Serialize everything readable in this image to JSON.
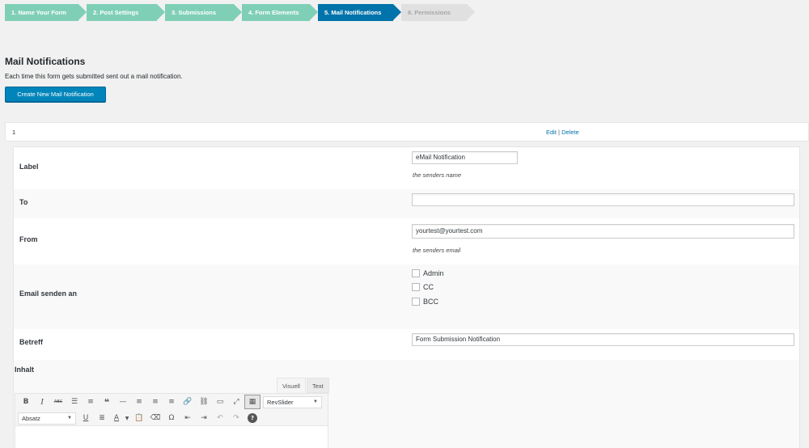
{
  "steps": [
    {
      "label": "1. Name Your Form"
    },
    {
      "label": "2. Post Settings"
    },
    {
      "label": "3. Submissions"
    },
    {
      "label": "4. Form Elements"
    },
    {
      "label": "5. Mail Notifications"
    },
    {
      "label": "6. Permissions"
    }
  ],
  "page": {
    "title": "Mail Notifications",
    "description": "Each time this form gets submitted sent out a mail notification.",
    "create_button": "Create New Mail Notification"
  },
  "notification": {
    "number": "1",
    "edit": "Edit",
    "separator": "|",
    "delete": "Delete"
  },
  "form": {
    "label": {
      "label": "Label",
      "value": "eMail Notification",
      "hint": "the senders name"
    },
    "to": {
      "label": "To",
      "value": ""
    },
    "from": {
      "label": "From",
      "value": "yourtest@yourtest.com",
      "hint": "the senders email"
    },
    "send_to": {
      "label": "Email senden an",
      "options": [
        "Admin",
        "CC",
        "BCC"
      ]
    },
    "subject": {
      "label": "Betreff",
      "value": "Form Submission Notification"
    },
    "content": {
      "label": "Inhalt"
    }
  },
  "editor": {
    "tab_visual": "Visuell",
    "tab_text": "Text",
    "shortcode_select": "RevSlider",
    "format_select": "Absatz",
    "toolbar_row1": [
      {
        "name": "bold-icon",
        "glyph": "B"
      },
      {
        "name": "italic-icon",
        "glyph": "I"
      },
      {
        "name": "strikethrough-icon",
        "glyph": "ABC"
      },
      {
        "name": "bullet-list-icon",
        "glyph": "☰"
      },
      {
        "name": "numbered-list-icon",
        "glyph": "≡"
      },
      {
        "name": "blockquote-icon",
        "glyph": "❝"
      },
      {
        "name": "horizontal-rule-icon",
        "glyph": "—"
      },
      {
        "name": "align-left-icon",
        "glyph": "≡"
      },
      {
        "name": "align-center-icon",
        "glyph": "≡"
      },
      {
        "name": "align-right-icon",
        "glyph": "≡"
      },
      {
        "name": "link-icon",
        "glyph": "🔗"
      },
      {
        "name": "unlink-icon",
        "glyph": "⛓"
      },
      {
        "name": "read-more-icon",
        "glyph": "▭"
      },
      {
        "name": "fullscreen-icon",
        "glyph": "⤢"
      },
      {
        "name": "toolbar-toggle-icon",
        "glyph": "▦"
      }
    ],
    "toolbar_row2": [
      {
        "name": "underline-icon",
        "glyph": "U"
      },
      {
        "name": "justify-icon",
        "glyph": "≣"
      },
      {
        "name": "text-color-icon",
        "glyph": "A"
      },
      {
        "name": "paste-text-icon",
        "glyph": "📋"
      },
      {
        "name": "clear-formatting-icon",
        "glyph": "⌫"
      },
      {
        "name": "special-character-icon",
        "glyph": "Ω"
      },
      {
        "name": "outdent-icon",
        "glyph": "⇤"
      },
      {
        "name": "indent-icon",
        "glyph": "⇥"
      },
      {
        "name": "undo-icon",
        "glyph": "↶"
      },
      {
        "name": "redo-icon",
        "glyph": "↷"
      },
      {
        "name": "help-icon",
        "glyph": "?"
      }
    ]
  },
  "colors": {
    "step_done": "#7fcfb6",
    "step_active": "#0073aa",
    "step_disabled": "#e0e0e0",
    "primary_button": "#0085ba",
    "link": "#0073aa"
  }
}
